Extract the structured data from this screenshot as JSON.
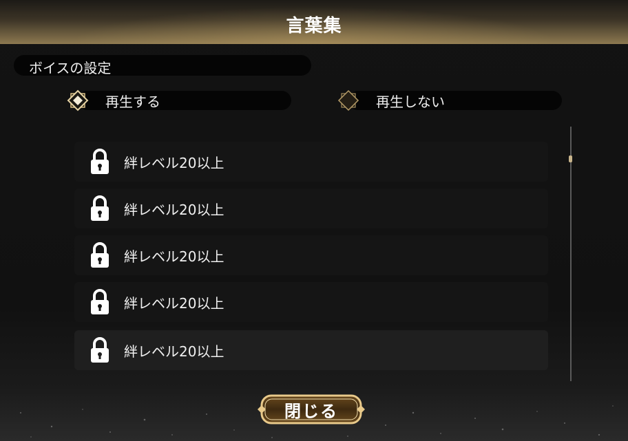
{
  "header": {
    "title": "言葉集"
  },
  "voice_settings": {
    "label": "ボイスの設定",
    "options": [
      {
        "label": "再生する",
        "selected": true
      },
      {
        "label": "再生しない",
        "selected": false
      }
    ]
  },
  "list": {
    "items": [
      {
        "label": "絆レベル20以上",
        "locked": true
      },
      {
        "label": "絆レベル20以上",
        "locked": true
      },
      {
        "label": "絆レベル20以上",
        "locked": true
      },
      {
        "label": "絆レベル20以上",
        "locked": true
      },
      {
        "label": "絆レベル20以上",
        "locked": true
      }
    ]
  },
  "footer": {
    "close_label": "閉じる"
  },
  "colors": {
    "accent_gold": "#c9a86a",
    "background": "#111111",
    "row": "#151515"
  }
}
